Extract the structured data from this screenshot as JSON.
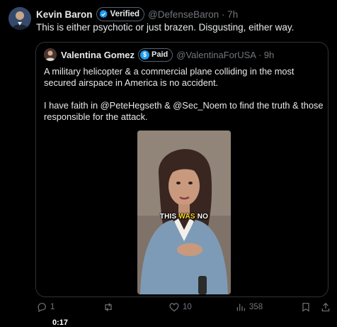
{
  "tweet": {
    "author_name": "Kevin Baron",
    "verified_label": "Verified",
    "handle_time": "@DefenseBaron · 7h",
    "text": "This is either psychotic or just brazen. Disgusting, either way."
  },
  "quoted": {
    "author_name": "Valentina Gomez",
    "paid_label": "Paid",
    "handle_time": "@ValentinaForUSA · 9h",
    "paragraph1": "A military helicopter & a commercial plane colliding in the most secured airspace in America is no accident.",
    "paragraph2": "I have faith in @PeteHegseth & @Sec_Noem to find the truth & those responsible for the attack.",
    "video": {
      "caption_1": "THIS",
      "caption_2": "WAS",
      "caption_3": "NO",
      "duration": "0:17"
    }
  },
  "actions": {
    "replies": "1",
    "retweets": "",
    "likes": "10",
    "views": "358"
  },
  "colors": {
    "background": "#000000",
    "text": "#e7e9ea",
    "muted": "#71767b",
    "verified_blue": "#1d9bf0",
    "caption_yellow": "#f3d523"
  }
}
